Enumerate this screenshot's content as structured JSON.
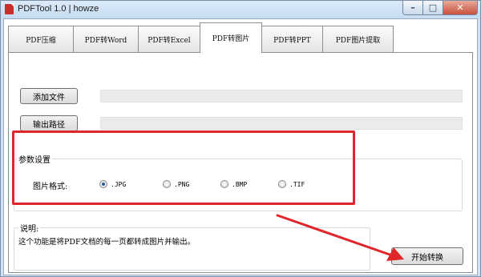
{
  "window": {
    "title": "PDFTool 1.0 | howze",
    "buttons": {
      "minimize": "–",
      "maximize": "□",
      "close": "✕"
    }
  },
  "tabs": [
    {
      "label": "PDF压缩",
      "active": false
    },
    {
      "label": "PDF转Word",
      "active": false
    },
    {
      "label": "PDF转Excel",
      "active": false
    },
    {
      "label": "PDF转图片",
      "active": true
    },
    {
      "label": "PDF转PPT",
      "active": false
    },
    {
      "label": "PDF图片提取",
      "active": false
    }
  ],
  "actions": {
    "add_file": "添加文件",
    "output_path": "输出路径",
    "start": "开始转换"
  },
  "settings": {
    "legend": "参数设置",
    "format_label": "图片格式:",
    "formats": [
      {
        "label": ".JPG",
        "selected": true
      },
      {
        "label": ".PNG",
        "selected": false
      },
      {
        "label": ".BMP",
        "selected": false
      },
      {
        "label": ".TIF",
        "selected": false
      }
    ]
  },
  "description": {
    "legend": "说明:",
    "text": "这个功能是将PDF文档的每一页都转成图片并输出。"
  },
  "colors": {
    "annotation": "#e0262b",
    "window_frame": "#cfe3f5",
    "radio_checked": "#2a5c99"
  }
}
